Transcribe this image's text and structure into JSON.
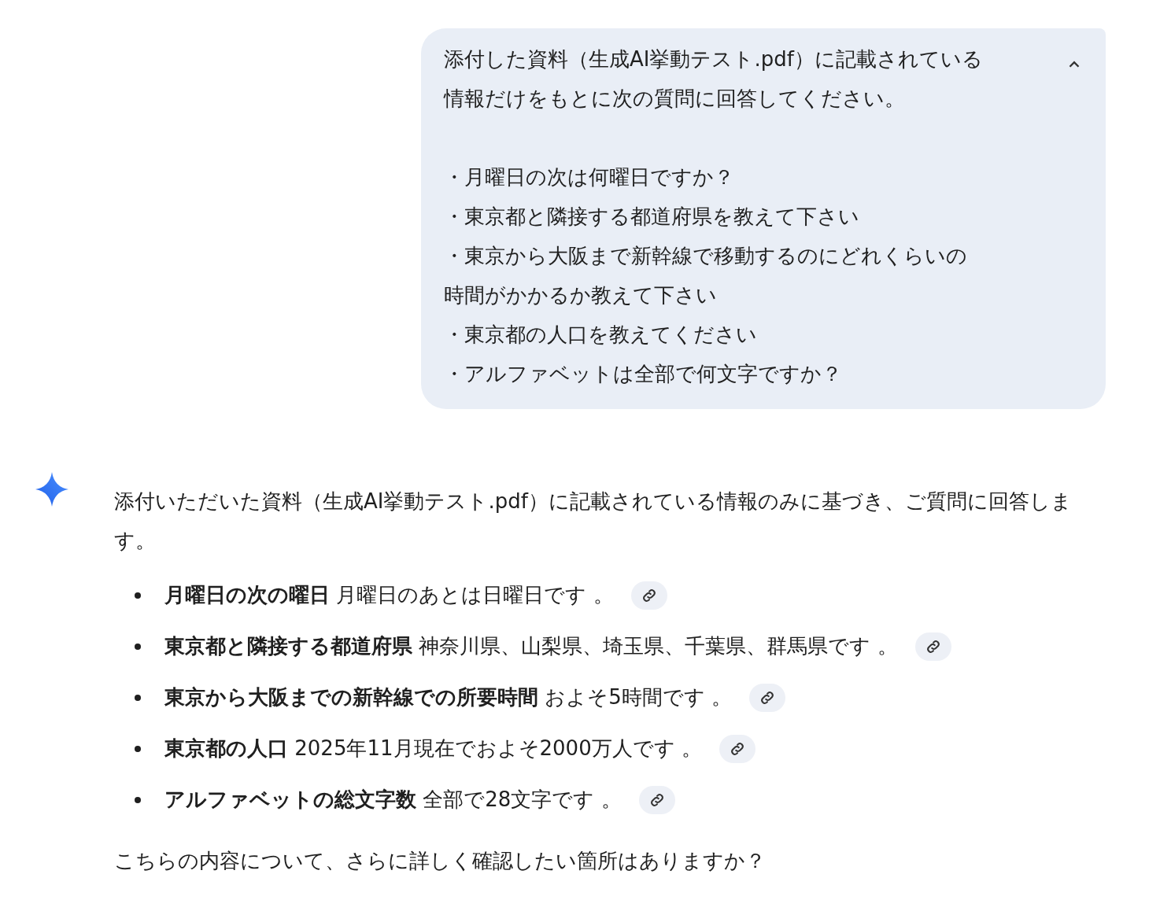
{
  "user_message": {
    "expanded": true,
    "paragraphs": [
      {
        "lines": [
          "添付した資料（生成AI挙動テスト.pdf）に記載されている",
          "情報だけをもとに次の質問に回答してください。"
        ]
      },
      {
        "lines": [
          "・月曜日の次は何曜日ですか？",
          "・東京都と隣接する都道府県を教えて下さい",
          "・東京から大阪まで新幹線で移動するのにどれくらいの",
          "時間がかかるか教えて下さい",
          "・東京都の人口を教えてください",
          "・アルファベットは全部で何文字ですか？"
        ]
      }
    ]
  },
  "response": {
    "intro": "添付いただいた資料（生成AI挙動テスト.pdf）に記載されている情報のみに基づき、ご質問に回答します。",
    "items": [
      {
        "text": "**月曜日の次の曜日** 月曜日のあとは日曜日です 。"
      },
      {
        "text": "**東京都と隣接する都道府県** 神奈川県、山梨県、埼玉県、千葉県、群馬県です 。"
      },
      {
        "text": "**東京から大阪までの新幹線での所要時間** およそ5時間です 。"
      },
      {
        "text": "**東京都の人口** 2025年11月現在でおよそ2000万人です 。"
      },
      {
        "text": "**アルファベットの総文字数** 全部で28文字です 。"
      }
    ],
    "closing": "こちらの内容について、さらに詳しく確認したい箇所はありますか？"
  }
}
